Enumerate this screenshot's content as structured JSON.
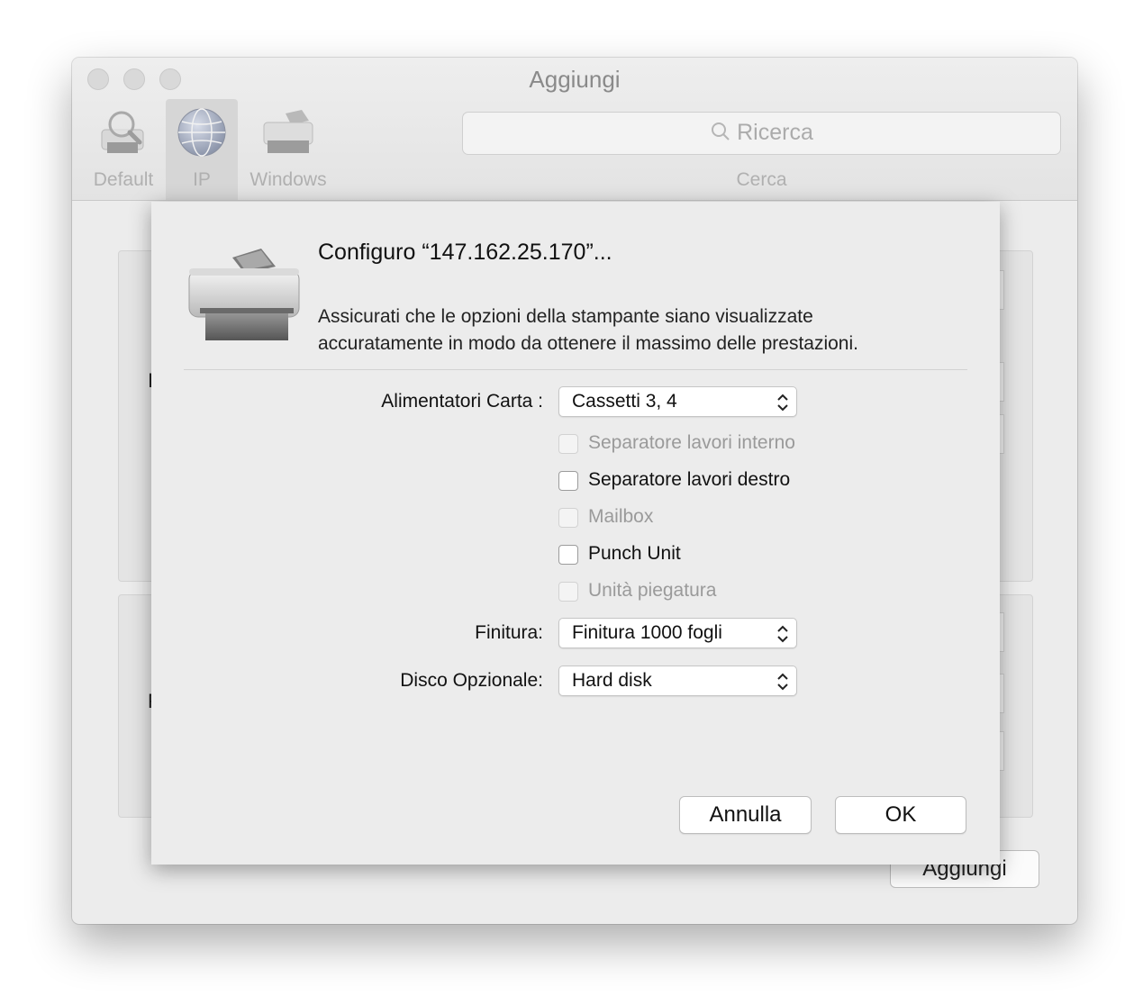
{
  "window": {
    "title": "Aggiungi"
  },
  "toolbar": {
    "items": [
      {
        "label": "Default",
        "icon": "default-printer-search-icon"
      },
      {
        "label": "IP",
        "icon": "globe-icon",
        "selected": true
      },
      {
        "label": "Windows",
        "icon": "windows-printer-icon"
      }
    ],
    "search_placeholder": "Ricerca",
    "search_label": "Cerca"
  },
  "background": {
    "add_button": "Aggiungi"
  },
  "sheet": {
    "heading": "Configuro “147.162.25.170”...",
    "description_line1": "Assicurati che le opzioni della stampante siano visualizzate",
    "description_line2": "accuratamente in modo da ottenere il massimo delle prestazioni.",
    "paper_trays": {
      "label": "Alimentatori Carta :",
      "value": "Cassetti 3, 4"
    },
    "checkboxes": [
      {
        "label": "Separatore lavori interno",
        "checked": false,
        "enabled": false
      },
      {
        "label": "Separatore lavori destro",
        "checked": false,
        "enabled": true
      },
      {
        "label": "Mailbox",
        "checked": false,
        "enabled": false
      },
      {
        "label": "Punch Unit",
        "checked": false,
        "enabled": true
      },
      {
        "label": "Unità piegatura",
        "checked": false,
        "enabled": false
      }
    ],
    "finisher": {
      "label": "Finitura:",
      "value": "Finitura 1000 fogli"
    },
    "optional_disk": {
      "label": "Disco Opzionale:",
      "value": "Hard disk"
    },
    "cancel_button": "Annulla",
    "ok_button": "OK"
  }
}
